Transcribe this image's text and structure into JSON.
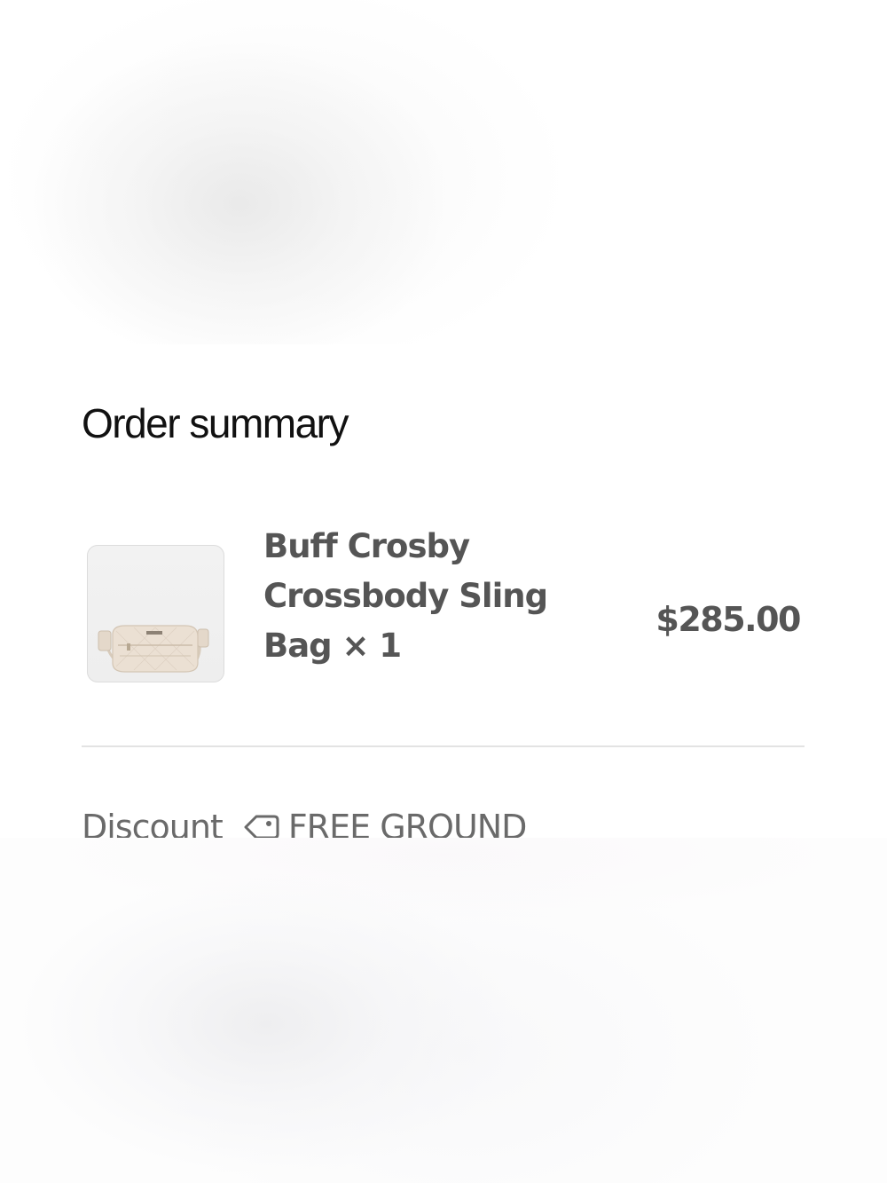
{
  "order_summary": {
    "title": "Order summary",
    "item": {
      "name": "Buff Crosby Crossbody Sling Bag",
      "quantity_text": "× 1",
      "price": "$285.00",
      "image_icon": "crossbody-bag-thumbnail"
    },
    "discount": {
      "label": "Discount",
      "icon": "tag-icon",
      "code": "FREE GROUND"
    }
  },
  "colors": {
    "title_text": "#111111",
    "item_text": "#555555",
    "muted_text": "#6a6a6a",
    "divider": "#e3e3e3",
    "bag": "#e9dccd"
  }
}
